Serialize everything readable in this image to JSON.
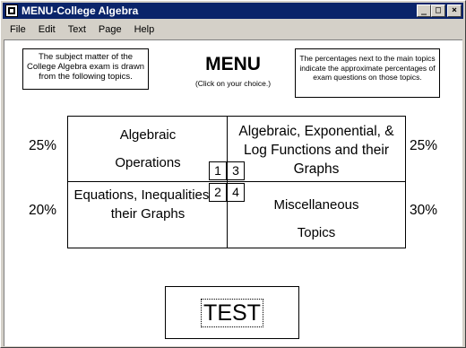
{
  "window": {
    "title": "MENU-College Algebra",
    "buttons": {
      "minimize": "_",
      "maximize": "□",
      "close": "×"
    }
  },
  "menubar": {
    "items": [
      "File",
      "Edit",
      "Text",
      "Page",
      "Help"
    ]
  },
  "notes": {
    "left": "The subject matter of the College Algebra exam is drawn from the following topics.",
    "right": "The percentages next to the main topics indicate the approximate percentages of exam questions on those topics."
  },
  "menu": {
    "title": "MENU",
    "subtitle": "(Click on your choice.)"
  },
  "topics": [
    {
      "number": "1",
      "line1": "Algebraic",
      "line2": "Operations",
      "percent": "25%"
    },
    {
      "number": "3",
      "label": "Algebraic, Exponential, & Log Functions and their Graphs",
      "percent": "25%"
    },
    {
      "number": "2",
      "label": "Equations, Inequalities & their Graphs",
      "percent": "20%"
    },
    {
      "number": "4",
      "line1": "Miscellaneous",
      "line2": "Topics",
      "percent": "30%"
    }
  ],
  "test_button": {
    "label": "TEST"
  }
}
